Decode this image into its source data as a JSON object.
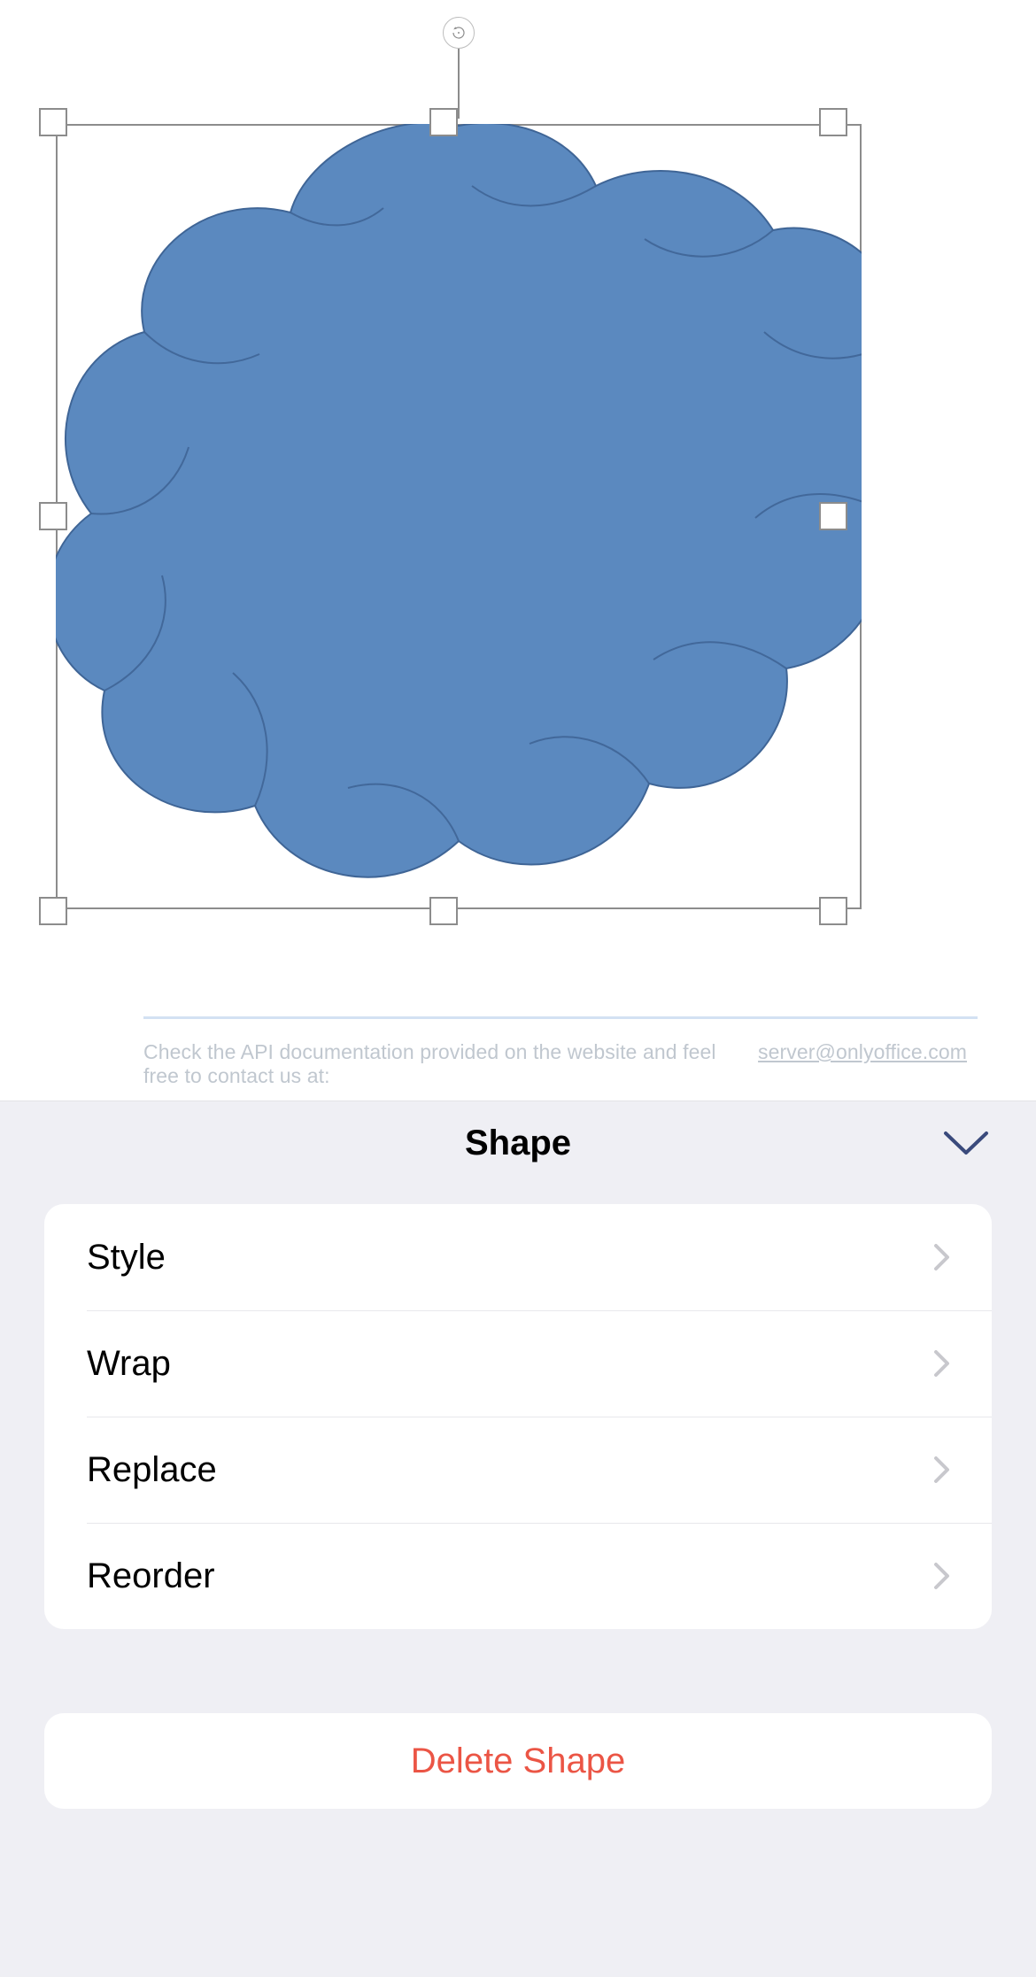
{
  "canvas": {
    "shape": {
      "fill": "#5b89bf",
      "stroke": "#3f6596"
    },
    "footer": {
      "text_a": "Check the API documentation provided on the website and feel free to contact us at:",
      "text_b": "server@onlyoffice.com"
    }
  },
  "panel": {
    "title": "Shape",
    "items": [
      {
        "label": "Style"
      },
      {
        "label": "Wrap"
      },
      {
        "label": "Replace"
      },
      {
        "label": "Reorder"
      }
    ],
    "delete_label": "Delete Shape",
    "colors": {
      "accent": "#3a4a7c",
      "danger": "#eb5545",
      "chevron": "#c8c8cd"
    }
  }
}
